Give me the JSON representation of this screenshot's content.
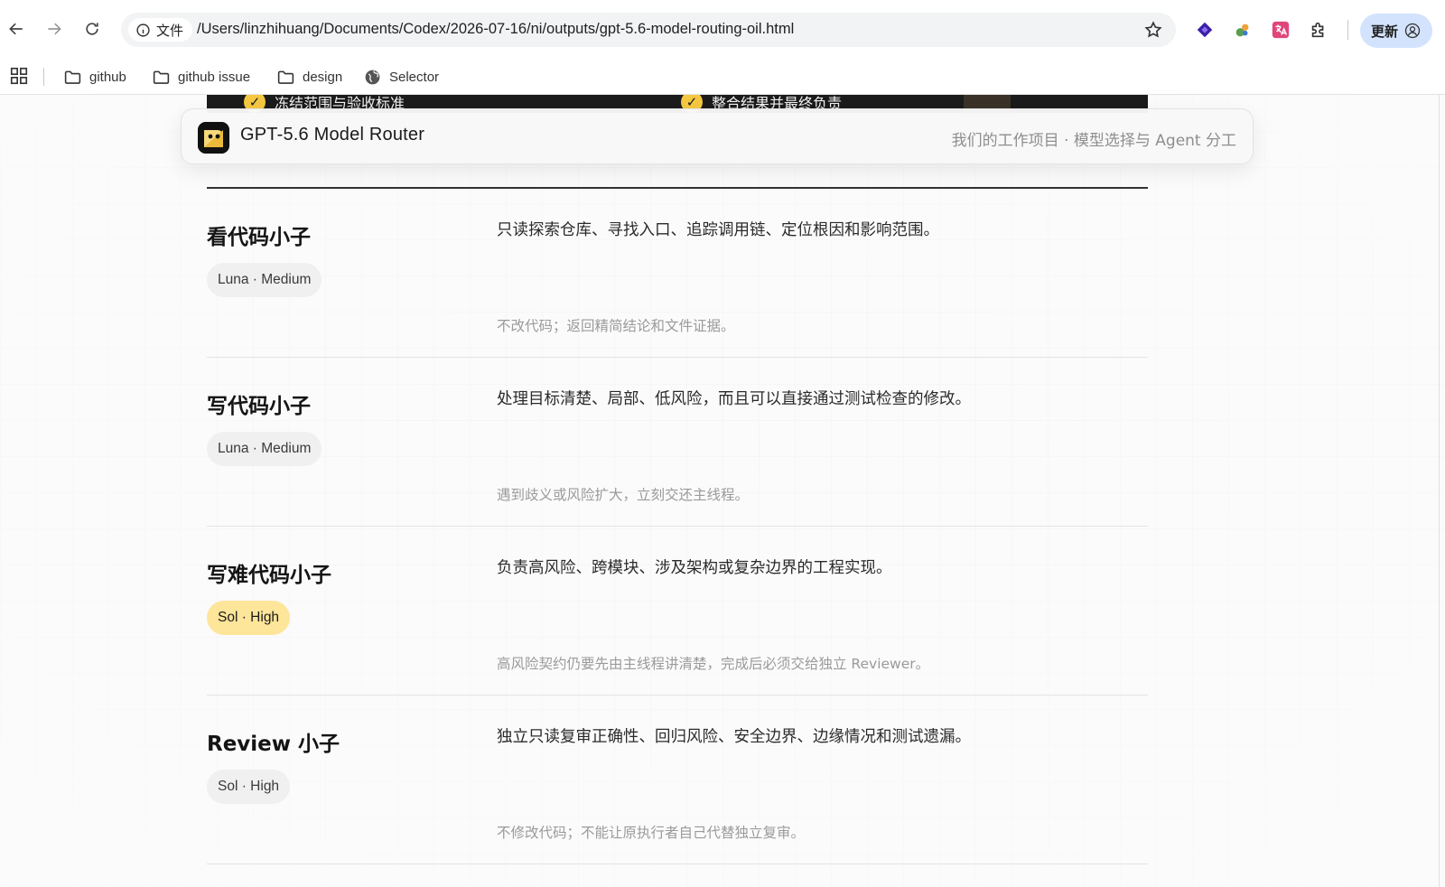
{
  "browser": {
    "site_info_label": "文件",
    "url": "/Users/linzhihuang/Documents/Codex/2026-07-16/ni/outputs/gpt-5.6-model-routing-oil.html",
    "update_label": "更新",
    "bookmarks": [
      {
        "label": "github",
        "icon": "folder-icon"
      },
      {
        "label": "github issue",
        "icon": "folder-icon"
      },
      {
        "label": "design",
        "icon": "folder-icon"
      },
      {
        "label": "Selector",
        "icon": "globe-icon"
      }
    ]
  },
  "page": {
    "strip_items": [
      {
        "label": "冻结范围与验收标准"
      },
      {
        "label": "整合结果并最终负责"
      }
    ],
    "header": {
      "brand": "GPT-5.6 Model Router",
      "subtitle": "我们的工作项目 · 模型选择与 Agent 分工"
    },
    "rows": [
      {
        "title": "看代码小子",
        "model": "Luna · Medium",
        "highlight": false,
        "description": "只读探索仓库、寻找入口、追踪调用链、定位根因和影响范围。",
        "note": "不改代码；返回精简结论和文件证据。"
      },
      {
        "title": "写代码小子",
        "model": "Luna · Medium",
        "highlight": false,
        "description": "处理目标清楚、局部、低风险，而且可以直接通过测试检查的修改。",
        "note": "遇到歧义或风险扩大，立刻交还主线程。"
      },
      {
        "title": "写难代码小子",
        "model": "Sol · High",
        "highlight": true,
        "description": "负责高风险、跨模块、涉及架构或复杂边界的工程实现。",
        "note": "高风险契约仍要先由主线程讲清楚，完成后必须交给独立 Reviewer。"
      },
      {
        "title": "Review 小子",
        "model": "Sol · High",
        "highlight": false,
        "description": "独立只读复审正确性、回归风险、安全边界、边缘情况和测试遗漏。",
        "note": "不修改代码；不能让原执行者自己代替独立复审。"
      }
    ]
  },
  "colors": {
    "accent_yellow": "#f5c842",
    "chip_highlight": "#fde59a",
    "update_button": "#d3e3fd"
  }
}
